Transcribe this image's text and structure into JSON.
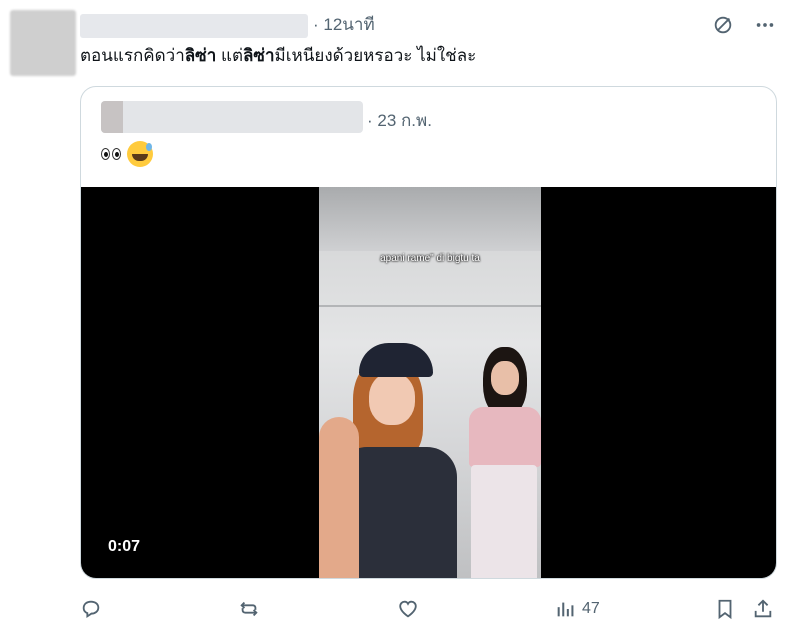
{
  "post": {
    "time": "· 12นาที",
    "text_parts": [
      "ตอนแรกคิดว่า",
      "ลิซ่า",
      " แต่",
      "ลิซ่า",
      "มีเหนียงด้วยหรอวะ ไม่ใช่ละ"
    ]
  },
  "quote": {
    "time": "· 23 ก.พ.",
    "emoji_eyes": "👀",
    "emoji_smile": "😅",
    "video": {
      "caption": "apani rame\" di bigtu ta",
      "duration": "0:07"
    }
  },
  "actions": {
    "views_count": "47"
  },
  "icons": {
    "grok": "grok-icon",
    "more": "more-icon",
    "reply": "reply-icon",
    "repost": "repost-icon",
    "like": "like-icon",
    "views": "views-icon",
    "bookmark": "bookmark-icon",
    "share": "share-icon"
  },
  "colors": {
    "text": "#0f1419",
    "secondary": "#536471",
    "border": "#cfd9de"
  }
}
